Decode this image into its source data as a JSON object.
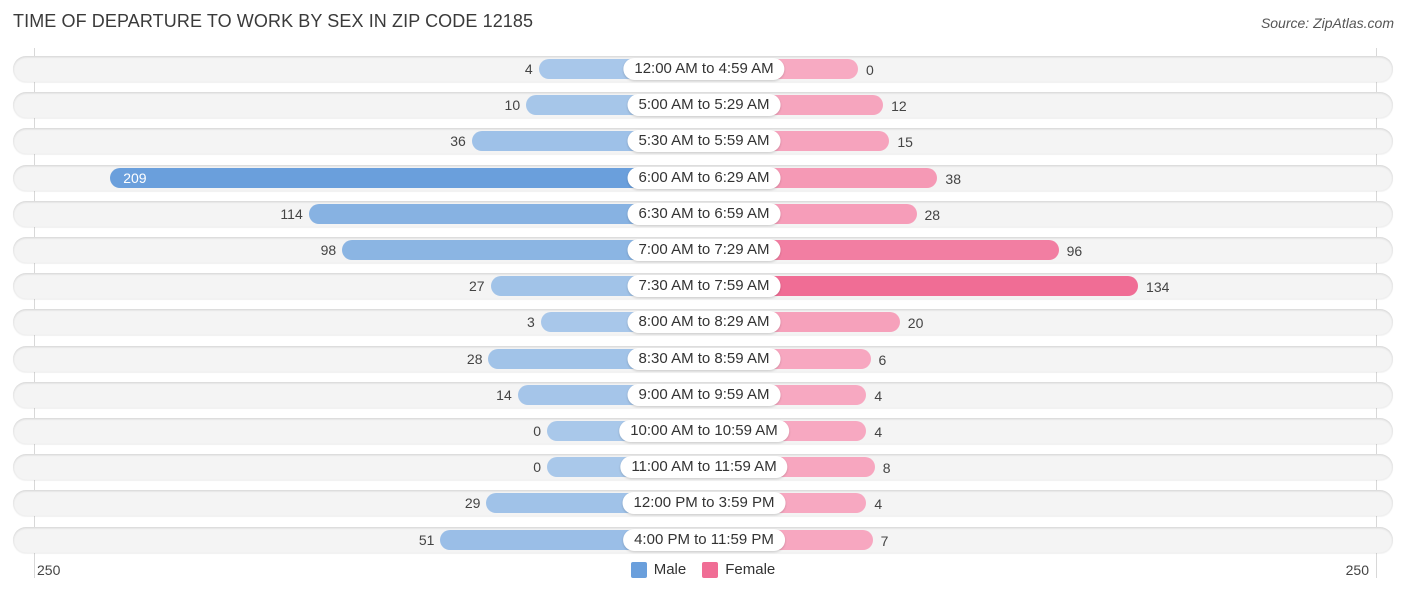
{
  "chart_data": {
    "type": "bar",
    "orientation": "horizontal-diverging",
    "title": "TIME OF DEPARTURE TO WORK BY SEX IN ZIP CODE 12185",
    "source": "Source: ZipAtlas.com",
    "categories": [
      "12:00 AM to 4:59 AM",
      "5:00 AM to 5:29 AM",
      "5:30 AM to 5:59 AM",
      "6:00 AM to 6:29 AM",
      "6:30 AM to 6:59 AM",
      "7:00 AM to 7:29 AM",
      "7:30 AM to 7:59 AM",
      "8:00 AM to 8:29 AM",
      "8:30 AM to 8:59 AM",
      "9:00 AM to 9:59 AM",
      "10:00 AM to 10:59 AM",
      "11:00 AM to 11:59 AM",
      "12:00 PM to 3:59 PM",
      "4:00 PM to 11:59 PM"
    ],
    "series": [
      {
        "name": "Male",
        "color": "#6a9fdc",
        "values": [
          4,
          10,
          36,
          209,
          114,
          98,
          27,
          3,
          28,
          14,
          0,
          0,
          29,
          51
        ]
      },
      {
        "name": "Female",
        "color": "#f06d95",
        "values": [
          0,
          12,
          15,
          38,
          28,
          96,
          134,
          20,
          6,
          4,
          4,
          8,
          4,
          7
        ]
      }
    ],
    "axis": {
      "left_label": "250",
      "right_label": "250",
      "max": 250
    },
    "legend": {
      "placement": "bottom-center",
      "items": [
        "Male",
        "Female"
      ]
    },
    "grid": false
  }
}
